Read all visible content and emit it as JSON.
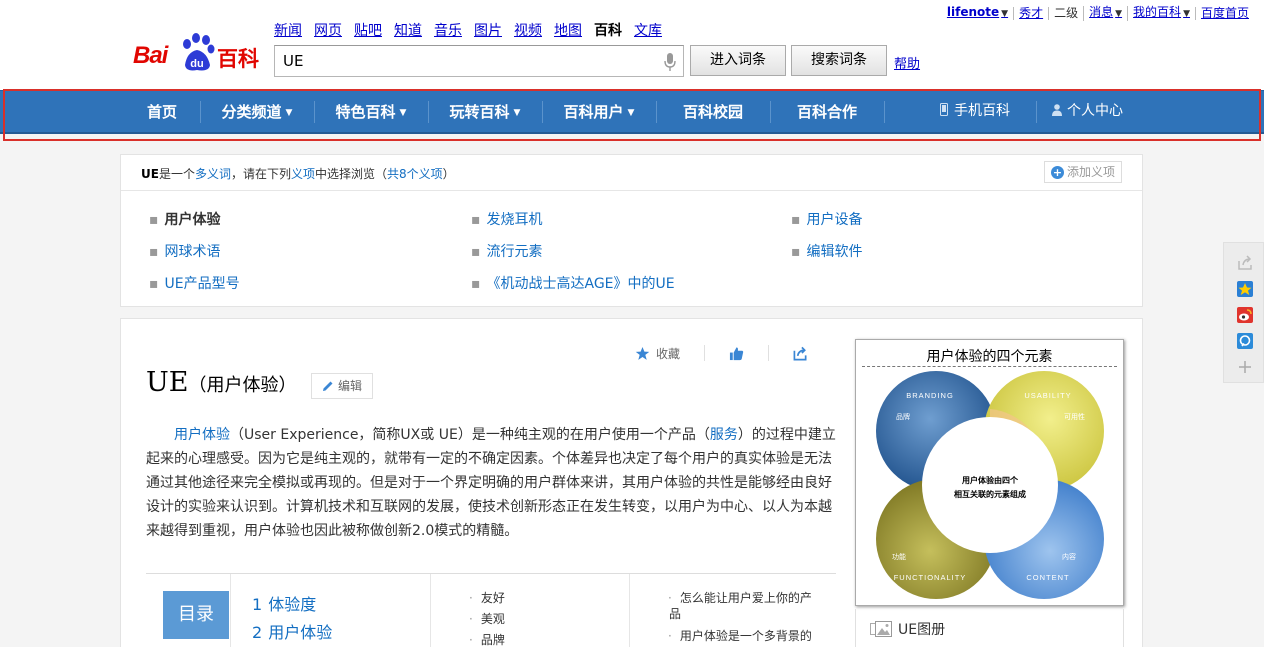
{
  "userbar": {
    "items": [
      {
        "label": "lifenote",
        "caret": true,
        "style": "link bold"
      },
      {
        "label": "秀才",
        "caret": false,
        "style": "link"
      },
      {
        "label": "二级",
        "caret": false,
        "style": ""
      },
      {
        "label": "消息",
        "caret": true,
        "style": "link"
      },
      {
        "label": "我的百科",
        "caret": true,
        "style": "link"
      },
      {
        "label": "百度首页",
        "caret": false,
        "style": "link"
      }
    ]
  },
  "logo": {
    "bai": "Bai",
    "du": "du",
    "baike": "百科"
  },
  "topnav": [
    {
      "label": "新闻"
    },
    {
      "label": "网页"
    },
    {
      "label": "贴吧"
    },
    {
      "label": "知道"
    },
    {
      "label": "音乐"
    },
    {
      "label": "图片"
    },
    {
      "label": "视频"
    },
    {
      "label": "地图"
    },
    {
      "label": "百科",
      "current": true
    },
    {
      "label": "文库"
    }
  ],
  "search": {
    "value": "UE",
    "enter_label": "进入词条",
    "search_label": "搜索词条",
    "help_label": "帮助"
  },
  "mainnav": {
    "items": [
      "首页",
      "分类频道",
      "特色百科",
      "玩转百科",
      "百科用户",
      "百科校园",
      "百科合作"
    ],
    "dropdown": [
      false,
      true,
      true,
      true,
      true,
      false,
      false
    ],
    "mobile": "手机百科",
    "personal": "个人中心"
  },
  "polysemant": {
    "term": "UE",
    "text1": "是一个",
    "link1": "多义词",
    "text2": "，请在下列",
    "link2": "义项",
    "text3": "中选择浏览（",
    "link3": "共8个义项",
    "text4": "）",
    "add_label": "添加义项",
    "senses": [
      "用户体验",
      "发烧耳机",
      "用户设备",
      "网球术语",
      "流行元素",
      "编辑软件",
      "UE产品型号",
      "《机动战士高达AGE》中的UE"
    ]
  },
  "tools": {
    "collect": "收藏",
    "like": "",
    "share": ""
  },
  "article": {
    "title": "UE",
    "subtitle": "（用户体验）",
    "edit_label": "编辑",
    "summary_link1": "用户体验",
    "summary_part1": "（User Experience，简称UX或 UE）是一种纯主观的在用户使用一个产品（",
    "summary_link2": "服务",
    "summary_part2": "）的过程中建立起来的心理感受。因为它是纯主观的，就带有一定的不确定因素。个体差异也决定了每个用户的真实体验是无法通过其他途径来完全模拟或再现的。但是对于一个界定明确的用户群体来讲，其用户体验的共性是能够经由良好设计的实验来认识到。计算机技术和互联网的发展，使技术创新形态正在发生转变，以用户为中心、以人为本越来越得到重视，用户体验也因此被称做创新2.0模式的精髓。"
  },
  "toc": {
    "label": "目录",
    "level1": [
      {
        "n": "1",
        "t": "体验度"
      },
      {
        "n": "2",
        "t": "用户体验"
      }
    ],
    "col2": [
      "友好",
      "美观",
      "品牌"
    ],
    "col3": [
      "怎么能让用户爱上你的产",
      "品",
      "用户体验是一个多背景的"
    ]
  },
  "card": {
    "title": "用户体验的四个元素",
    "branding": "BRANDING",
    "branding_cn": "品牌",
    "usability": "USABILITY",
    "usability_cn": "可用性",
    "functionality": "FUNCTIONALITY",
    "functionality_cn": "功能",
    "content": "CONTENT",
    "content_cn": "内容",
    "center_line1": "用户体验由四个",
    "center_line2": "相互关联的元素组成",
    "album_label": "UE图册"
  },
  "colors": {
    "nav_blue": "#2f73b9",
    "link": "#136ec2",
    "logo_red": "#e10601",
    "highlight_border": "#d9302a"
  }
}
